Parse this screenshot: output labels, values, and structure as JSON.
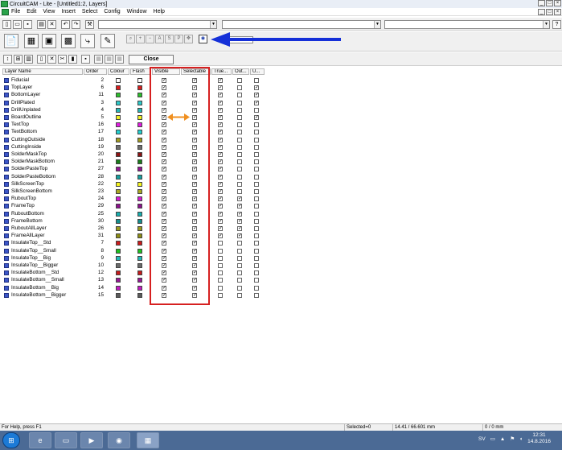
{
  "window": {
    "title": "CircuitCAM - Lite - [Untitled1:2, Layers]"
  },
  "menu": [
    "File",
    "Edit",
    "View",
    "Insert",
    "Select",
    "Config",
    "Window",
    "Help"
  ],
  "toolbar3": {
    "close_label": "Close"
  },
  "table": {
    "headers": [
      "Layer Name",
      "Order",
      "Colour",
      "Flash",
      "Visible",
      "Selectable",
      "True...",
      "Out...",
      "U..."
    ],
    "rows": [
      {
        "name": "Fiducial",
        "order": "2",
        "colour": "#ffffff",
        "flash": "#ffffff",
        "vis": true,
        "sel": true,
        "tru": true,
        "out": false,
        "u": false
      },
      {
        "name": "TopLayer",
        "order": "6",
        "colour": "#d81e1e",
        "flash": "#d81e1e",
        "vis": true,
        "sel": true,
        "tru": true,
        "out": false,
        "u": true
      },
      {
        "name": "BottomLayer",
        "order": "11",
        "colour": "#2bbf2b",
        "flash": "#2bbf2b",
        "vis": true,
        "sel": true,
        "tru": true,
        "out": false,
        "u": true
      },
      {
        "name": "DrillPlated",
        "order": "3",
        "colour": "#2cc9c9",
        "flash": "#2cc9c9",
        "vis": true,
        "sel": true,
        "tru": true,
        "out": false,
        "u": true
      },
      {
        "name": "DrillUnplated",
        "order": "4",
        "colour": "#27b6b6",
        "flash": "#27b6b6",
        "vis": true,
        "sel": true,
        "tru": true,
        "out": false,
        "u": false
      },
      {
        "name": "BoardOutline",
        "order": "5",
        "colour": "#f0f020",
        "flash": "#f0f020",
        "vis": true,
        "sel": true,
        "tru": true,
        "out": false,
        "u": true
      },
      {
        "name": "TextTop",
        "order": "16",
        "colour": "#e11de1",
        "flash": "#e11de1",
        "vis": true,
        "sel": true,
        "tru": true,
        "out": false,
        "u": false
      },
      {
        "name": "TextBottom",
        "order": "17",
        "colour": "#22d0d0",
        "flash": "#22d0d0",
        "vis": true,
        "sel": true,
        "tru": true,
        "out": false,
        "u": false
      },
      {
        "name": "CuttingOutside",
        "order": "18",
        "colour": "#a39c1e",
        "flash": "#a39c1e",
        "vis": true,
        "sel": true,
        "tru": true,
        "out": false,
        "u": false
      },
      {
        "name": "CuttingInside",
        "order": "19",
        "colour": "#6d6d6d",
        "flash": "#6d6d6d",
        "vis": true,
        "sel": true,
        "tru": true,
        "out": false,
        "u": false
      },
      {
        "name": "SolderMaskTop",
        "order": "20",
        "colour": "#8c1414",
        "flash": "#8c1414",
        "vis": true,
        "sel": true,
        "tru": true,
        "out": false,
        "u": false
      },
      {
        "name": "SolderMaskBottom",
        "order": "21",
        "colour": "#1a7d1a",
        "flash": "#1a7d1a",
        "vis": true,
        "sel": true,
        "tru": true,
        "out": false,
        "u": false
      },
      {
        "name": "SolderPasteTop",
        "order": "27",
        "colour": "#941494",
        "flash": "#941494",
        "vis": true,
        "sel": true,
        "tru": true,
        "out": false,
        "u": false
      },
      {
        "name": "SolderPasteBottom",
        "order": "28",
        "colour": "#16a0a0",
        "flash": "#16a0a0",
        "vis": true,
        "sel": true,
        "tru": true,
        "out": false,
        "u": false
      },
      {
        "name": "SilkScreenTop",
        "order": "22",
        "colour": "#f5f51e",
        "flash": "#f5f51e",
        "vis": true,
        "sel": true,
        "tru": true,
        "out": false,
        "u": false
      },
      {
        "name": "SilkScreenBottom",
        "order": "23",
        "colour": "#a9a922",
        "flash": "#a9a922",
        "vis": true,
        "sel": true,
        "tru": true,
        "out": false,
        "u": false
      },
      {
        "name": "RuboutTop",
        "order": "24",
        "colour": "#d51ad5",
        "flash": "#d51ad5",
        "vis": true,
        "sel": true,
        "tru": true,
        "out": true,
        "u": false
      },
      {
        "name": "FrameTop",
        "order": "29",
        "colour": "#8d118d",
        "flash": "#8d118d",
        "vis": true,
        "sel": true,
        "tru": true,
        "out": true,
        "u": false
      },
      {
        "name": "RuboutBottom",
        "order": "25",
        "colour": "#18aeae",
        "flash": "#18aeae",
        "vis": true,
        "sel": true,
        "tru": true,
        "out": true,
        "u": false
      },
      {
        "name": "FrameBottom",
        "order": "30",
        "colour": "#148e8e",
        "flash": "#148e8e",
        "vis": true,
        "sel": true,
        "tru": true,
        "out": true,
        "u": false
      },
      {
        "name": "RuboutAllLayer",
        "order": "26",
        "colour": "#9a9a1c",
        "flash": "#9a9a1c",
        "vis": true,
        "sel": true,
        "tru": true,
        "out": true,
        "u": false
      },
      {
        "name": "FrameAllLayer",
        "order": "31",
        "colour": "#8e8e14",
        "flash": "#8e8e14",
        "vis": true,
        "sel": true,
        "tru": true,
        "out": true,
        "u": false
      },
      {
        "name": "InsulateTop__Std",
        "order": "7",
        "colour": "#cc1b1b",
        "flash": "#cc1b1b",
        "vis": true,
        "sel": true,
        "tru": false,
        "out": false,
        "u": false
      },
      {
        "name": "InsulateTop__Small",
        "order": "8",
        "colour": "#1ec21e",
        "flash": "#1ec21e",
        "vis": true,
        "sel": true,
        "tru": false,
        "out": false,
        "u": false
      },
      {
        "name": "InsulateTop__Big",
        "order": "9",
        "colour": "#22b9b9",
        "flash": "#22b9b9",
        "vis": true,
        "sel": true,
        "tru": false,
        "out": false,
        "u": false
      },
      {
        "name": "InsulateTop__Bigger",
        "order": "10",
        "colour": "#6a6a6a",
        "flash": "#6a6a6a",
        "vis": true,
        "sel": true,
        "tru": false,
        "out": false,
        "u": false
      },
      {
        "name": "InsulateBottom__Std",
        "order": "12",
        "colour": "#c61b1b",
        "flash": "#c61b1b",
        "vis": true,
        "sel": true,
        "tru": false,
        "out": false,
        "u": false
      },
      {
        "name": "InsulateBottom__Small",
        "order": "13",
        "colour": "#961896",
        "flash": "#961896",
        "vis": true,
        "sel": true,
        "tru": false,
        "out": false,
        "u": false
      },
      {
        "name": "InsulateBottom__Big",
        "order": "14",
        "colour": "#c21bc2",
        "flash": "#c21bc2",
        "vis": true,
        "sel": true,
        "tru": false,
        "out": false,
        "u": false
      },
      {
        "name": "InsulateBottom__Bigger",
        "order": "15",
        "colour": "#5a5a5a",
        "flash": "#5a5a5a",
        "vis": true,
        "sel": true,
        "tru": false,
        "out": false,
        "u": false
      }
    ]
  },
  "statusbar": {
    "help": "For Help, press F1",
    "selected": "Selected=0",
    "coords": "14.41 / 66.601 mm",
    "zero": "0 / 0 mm"
  },
  "taskbar": {
    "lang": "SV",
    "time": "12:31",
    "date": "14.8.2016"
  },
  "colors": {
    "highlight_box": "#d62020",
    "annotation_arrow_blue": "#1530d8",
    "annotation_arrow_orange": "#f09020"
  }
}
